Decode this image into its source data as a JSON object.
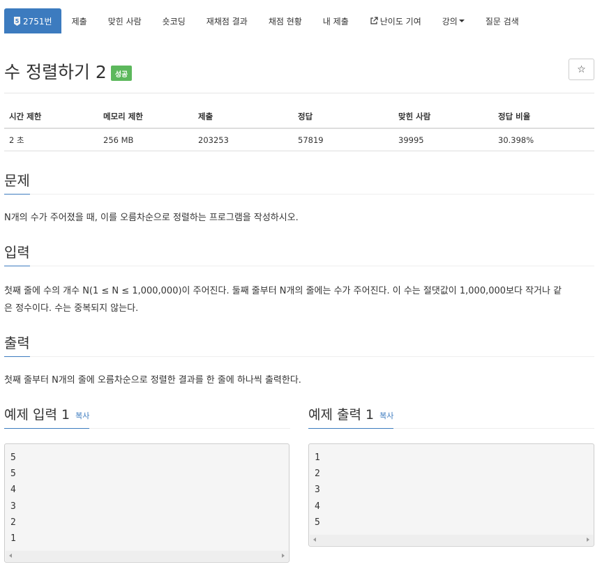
{
  "nav": {
    "tabs": [
      {
        "label": "2751번",
        "active": true
      },
      {
        "label": "제출"
      },
      {
        "label": "맞힌 사람"
      },
      {
        "label": "숏코딩"
      },
      {
        "label": "재채점 결과"
      },
      {
        "label": "채점 현황"
      },
      {
        "label": "내 제출"
      },
      {
        "label": "난이도 기여"
      },
      {
        "label": "강의"
      },
      {
        "label": "질문 검색"
      }
    ],
    "badge_digit": "5"
  },
  "problem": {
    "title": "수 정렬하기 2",
    "status": "성공",
    "star": "☆"
  },
  "info": {
    "headers": [
      "시간 제한",
      "메모리 제한",
      "제출",
      "정답",
      "맞힌 사람",
      "정답 비율"
    ],
    "values": [
      "2 초",
      "256 MB",
      "203253",
      "57819",
      "39995",
      "30.398%"
    ]
  },
  "sections": {
    "problem_heading": "문제",
    "problem_text": "N개의 수가 주어졌을 때, 이를 오름차순으로 정렬하는 프로그램을 작성하시오.",
    "input_heading": "입력",
    "input_text_1": "첫째 줄에 수의 개수 N(1 ≤ N ≤ 1,000,000)이 주어진다. 둘째 줄부터 N개의 줄에는 수가 주어진다. 이 수는 절댓값이 1,000,000보다 작거나 같",
    "input_text_2": "은 정수이다. 수는 중복되지 않는다.",
    "output_heading": "출력",
    "output_text": "첫째 줄부터 N개의 줄에 오름차순으로 정렬한 결과를 한 줄에 하나씩 출력한다."
  },
  "samples": {
    "input_heading": "예제 입력 1",
    "output_heading": "예제 출력 1",
    "copy_label": "복사",
    "input_data": "5\n5\n4\n3\n2\n1",
    "output_data": "1\n2\n3\n4\n5"
  }
}
